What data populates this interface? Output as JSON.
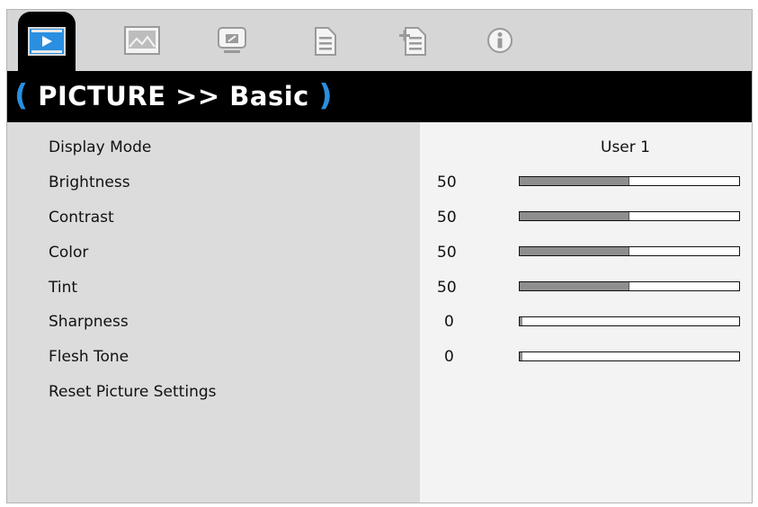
{
  "tabs": [
    {
      "icon": "picture-icon",
      "active": true
    },
    {
      "icon": "display-icon",
      "active": false
    },
    {
      "icon": "setup-icon",
      "active": false
    },
    {
      "icon": "options-icon",
      "active": false
    },
    {
      "icon": "options-advanced-icon",
      "active": false
    },
    {
      "icon": "info-icon",
      "active": false
    }
  ],
  "header": {
    "open": "(",
    "title": "PICTURE >> Basic",
    "close": ")"
  },
  "menu": {
    "display_mode": {
      "label": "Display Mode",
      "value": "User 1"
    },
    "brightness": {
      "label": "Brightness",
      "value": "50",
      "level": 0.5
    },
    "contrast": {
      "label": "Contrast",
      "value": "50",
      "level": 0.5
    },
    "color": {
      "label": "Color",
      "value": "50",
      "level": 0.5
    },
    "tint": {
      "label": "Tint",
      "value": "50",
      "level": 0.5
    },
    "sharpness": {
      "label": "Sharpness",
      "value": "0",
      "level": 0.0
    },
    "flesh_tone": {
      "label": "Flesh Tone",
      "value": "0",
      "level": 0.0
    },
    "reset": {
      "label": "Reset Picture Settings"
    }
  },
  "colors": {
    "accent": "#2a8fe0",
    "tab_bg": "#d6d6d6",
    "bar_fill": "#8e8e8e"
  }
}
